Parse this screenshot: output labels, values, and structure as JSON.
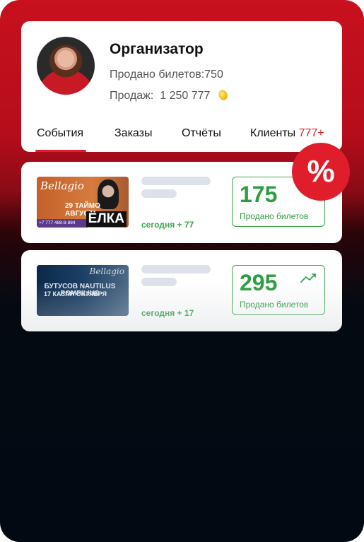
{
  "profile": {
    "role": "Организатор",
    "tickets_sold_label": "Продано билетов:",
    "tickets_sold_value": "750",
    "sales_label": "Продаж:",
    "sales_value": "1 250 777"
  },
  "tabs": [
    {
      "label": "События",
      "active": true
    },
    {
      "label": "Заказы"
    },
    {
      "label": "Отчёты"
    },
    {
      "label": "Клиенты",
      "badge": "777+"
    }
  ],
  "events": [
    {
      "poster_brand": "Bellagio",
      "poster_date": "29 ТАЙМО АВГУСТА",
      "poster_phone": "+7 777 488-8-884",
      "poster_title": "ЁЛКА",
      "today": "сегодня + 77",
      "sold_value": "175",
      "sold_label": "Продано билетов"
    },
    {
      "poster_brand": "Bellagio",
      "poster_date": "17 КАЗАН ОКТЯБРЯ",
      "poster_title": "БУТУСОВ NAUTILUS POMPILIUS",
      "today": "сегодня + 17",
      "sold_value": "295",
      "sold_label": "Продано билетов"
    }
  ],
  "badge": {
    "symbol": "%"
  },
  "colors": {
    "accent": "#e01e2b",
    "success": "#2e9e42",
    "skeleton": "#dde2ea"
  }
}
